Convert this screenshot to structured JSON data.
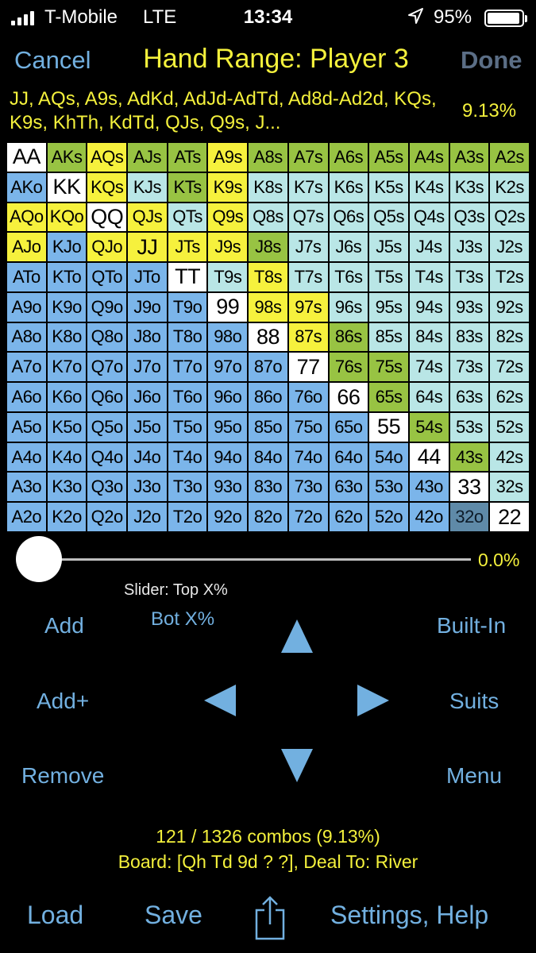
{
  "status": {
    "carrier": "T-Mobile",
    "network": "LTE",
    "time": "13:34",
    "battery": "95%"
  },
  "nav": {
    "cancel": "Cancel",
    "title": "Hand Range: Player 3",
    "done": "Done"
  },
  "range": {
    "text": "JJ, AQs, A9s, AdKd, AdJd-AdTd, Ad8d-Ad2d, KQs, K9s, KhTh, KdTd, QJs, Q9s, J...",
    "percent": "9.13%"
  },
  "grid": [
    [
      [
        "AA",
        "w"
      ],
      [
        "AKs",
        "g"
      ],
      [
        "AQs",
        "y"
      ],
      [
        "AJs",
        "g"
      ],
      [
        "ATs",
        "g"
      ],
      [
        "A9s",
        "y"
      ],
      [
        "A8s",
        "g"
      ],
      [
        "A7s",
        "g"
      ],
      [
        "A6s",
        "g"
      ],
      [
        "A5s",
        "g"
      ],
      [
        "A4s",
        "g"
      ],
      [
        "A3s",
        "g"
      ],
      [
        "A2s",
        "g"
      ]
    ],
    [
      [
        "AKo",
        "b"
      ],
      [
        "KK",
        "w"
      ],
      [
        "KQs",
        "y"
      ],
      [
        "KJs",
        "lt"
      ],
      [
        "KTs",
        "g"
      ],
      [
        "K9s",
        "y"
      ],
      [
        "K8s",
        "lt"
      ],
      [
        "K7s",
        "lt"
      ],
      [
        "K6s",
        "lt"
      ],
      [
        "K5s",
        "lt"
      ],
      [
        "K4s",
        "lt"
      ],
      [
        "K3s",
        "lt"
      ],
      [
        "K2s",
        "lt"
      ]
    ],
    [
      [
        "AQo",
        "y"
      ],
      [
        "KQo",
        "y"
      ],
      [
        "QQ",
        "w"
      ],
      [
        "QJs",
        "y"
      ],
      [
        "QTs",
        "lt"
      ],
      [
        "Q9s",
        "y"
      ],
      [
        "Q8s",
        "lt"
      ],
      [
        "Q7s",
        "lt"
      ],
      [
        "Q6s",
        "lt"
      ],
      [
        "Q5s",
        "lt"
      ],
      [
        "Q4s",
        "lt"
      ],
      [
        "Q3s",
        "lt"
      ],
      [
        "Q2s",
        "lt"
      ]
    ],
    [
      [
        "AJo",
        "y"
      ],
      [
        "KJo",
        "b"
      ],
      [
        "QJo",
        "y"
      ],
      [
        "JJ",
        "y"
      ],
      [
        "JTs",
        "y"
      ],
      [
        "J9s",
        "y"
      ],
      [
        "J8s",
        "g"
      ],
      [
        "J7s",
        "lt"
      ],
      [
        "J6s",
        "lt"
      ],
      [
        "J5s",
        "lt"
      ],
      [
        "J4s",
        "lt"
      ],
      [
        "J3s",
        "lt"
      ],
      [
        "J2s",
        "lt"
      ]
    ],
    [
      [
        "ATo",
        "b"
      ],
      [
        "KTo",
        "b"
      ],
      [
        "QTo",
        "b"
      ],
      [
        "JTo",
        "b"
      ],
      [
        "TT",
        "w"
      ],
      [
        "T9s",
        "lt"
      ],
      [
        "T8s",
        "y"
      ],
      [
        "T7s",
        "lt"
      ],
      [
        "T6s",
        "lt"
      ],
      [
        "T5s",
        "lt"
      ],
      [
        "T4s",
        "lt"
      ],
      [
        "T3s",
        "lt"
      ],
      [
        "T2s",
        "lt"
      ]
    ],
    [
      [
        "A9o",
        "b"
      ],
      [
        "K9o",
        "b"
      ],
      [
        "Q9o",
        "b"
      ],
      [
        "J9o",
        "b"
      ],
      [
        "T9o",
        "b"
      ],
      [
        "99",
        "w"
      ],
      [
        "98s",
        "y"
      ],
      [
        "97s",
        "y"
      ],
      [
        "96s",
        "lt"
      ],
      [
        "95s",
        "lt"
      ],
      [
        "94s",
        "lt"
      ],
      [
        "93s",
        "lt"
      ],
      [
        "92s",
        "lt"
      ]
    ],
    [
      [
        "A8o",
        "b"
      ],
      [
        "K8o",
        "b"
      ],
      [
        "Q8o",
        "b"
      ],
      [
        "J8o",
        "b"
      ],
      [
        "T8o",
        "b"
      ],
      [
        "98o",
        "b"
      ],
      [
        "88",
        "w"
      ],
      [
        "87s",
        "y"
      ],
      [
        "86s",
        "g"
      ],
      [
        "85s",
        "lt"
      ],
      [
        "84s",
        "lt"
      ],
      [
        "83s",
        "lt"
      ],
      [
        "82s",
        "lt"
      ]
    ],
    [
      [
        "A7o",
        "b"
      ],
      [
        "K7o",
        "b"
      ],
      [
        "Q7o",
        "b"
      ],
      [
        "J7o",
        "b"
      ],
      [
        "T7o",
        "b"
      ],
      [
        "97o",
        "b"
      ],
      [
        "87o",
        "b"
      ],
      [
        "77",
        "w"
      ],
      [
        "76s",
        "g"
      ],
      [
        "75s",
        "g"
      ],
      [
        "74s",
        "lt"
      ],
      [
        "73s",
        "lt"
      ],
      [
        "72s",
        "lt"
      ]
    ],
    [
      [
        "A6o",
        "b"
      ],
      [
        "K6o",
        "b"
      ],
      [
        "Q6o",
        "b"
      ],
      [
        "J6o",
        "b"
      ],
      [
        "T6o",
        "b"
      ],
      [
        "96o",
        "b"
      ],
      [
        "86o",
        "b"
      ],
      [
        "76o",
        "b"
      ],
      [
        "66",
        "w"
      ],
      [
        "65s",
        "g"
      ],
      [
        "64s",
        "lt"
      ],
      [
        "63s",
        "lt"
      ],
      [
        "62s",
        "lt"
      ]
    ],
    [
      [
        "A5o",
        "b"
      ],
      [
        "K5o",
        "b"
      ],
      [
        "Q5o",
        "b"
      ],
      [
        "J5o",
        "b"
      ],
      [
        "T5o",
        "b"
      ],
      [
        "95o",
        "b"
      ],
      [
        "85o",
        "b"
      ],
      [
        "75o",
        "b"
      ],
      [
        "65o",
        "b"
      ],
      [
        "55",
        "w"
      ],
      [
        "54s",
        "g"
      ],
      [
        "53s",
        "lt"
      ],
      [
        "52s",
        "lt"
      ]
    ],
    [
      [
        "A4o",
        "b"
      ],
      [
        "K4o",
        "b"
      ],
      [
        "Q4o",
        "b"
      ],
      [
        "J4o",
        "b"
      ],
      [
        "T4o",
        "b"
      ],
      [
        "94o",
        "b"
      ],
      [
        "84o",
        "b"
      ],
      [
        "74o",
        "b"
      ],
      [
        "64o",
        "b"
      ],
      [
        "54o",
        "b"
      ],
      [
        "44",
        "w"
      ],
      [
        "43s",
        "g"
      ],
      [
        "42s",
        "lt"
      ]
    ],
    [
      [
        "A3o",
        "b"
      ],
      [
        "K3o",
        "b"
      ],
      [
        "Q3o",
        "b"
      ],
      [
        "J3o",
        "b"
      ],
      [
        "T3o",
        "b"
      ],
      [
        "93o",
        "b"
      ],
      [
        "83o",
        "b"
      ],
      [
        "73o",
        "b"
      ],
      [
        "63o",
        "b"
      ],
      [
        "53o",
        "b"
      ],
      [
        "43o",
        "b"
      ],
      [
        "33",
        "w"
      ],
      [
        "32s",
        "lt"
      ]
    ],
    [
      [
        "A2o",
        "b"
      ],
      [
        "K2o",
        "b"
      ],
      [
        "Q2o",
        "b"
      ],
      [
        "J2o",
        "b"
      ],
      [
        "T2o",
        "b"
      ],
      [
        "92o",
        "b"
      ],
      [
        "82o",
        "b"
      ],
      [
        "72o",
        "b"
      ],
      [
        "62o",
        "b"
      ],
      [
        "52o",
        "b"
      ],
      [
        "42o",
        "b"
      ],
      [
        "32o",
        "d"
      ],
      [
        "22",
        "w"
      ]
    ]
  ],
  "slider": {
    "value": "0.0%",
    "fraction": 0.0,
    "caption": "Slider: Top X%",
    "bot_label": "Bot X%"
  },
  "buttons": {
    "add": "Add",
    "built_in": "Built-In",
    "add_plus": "Add+",
    "suits": "Suits",
    "remove": "Remove",
    "menu": "Menu"
  },
  "summary": {
    "combos": "121 / 1326 combos (9.13%)",
    "board": "Board: [Qh Td 9d ? ?], Deal To: River"
  },
  "toolbar": {
    "load": "Load",
    "save": "Save",
    "settings": "Settings, Help"
  },
  "icons": {
    "share": "share-icon",
    "location": "location-arrow-icon"
  }
}
